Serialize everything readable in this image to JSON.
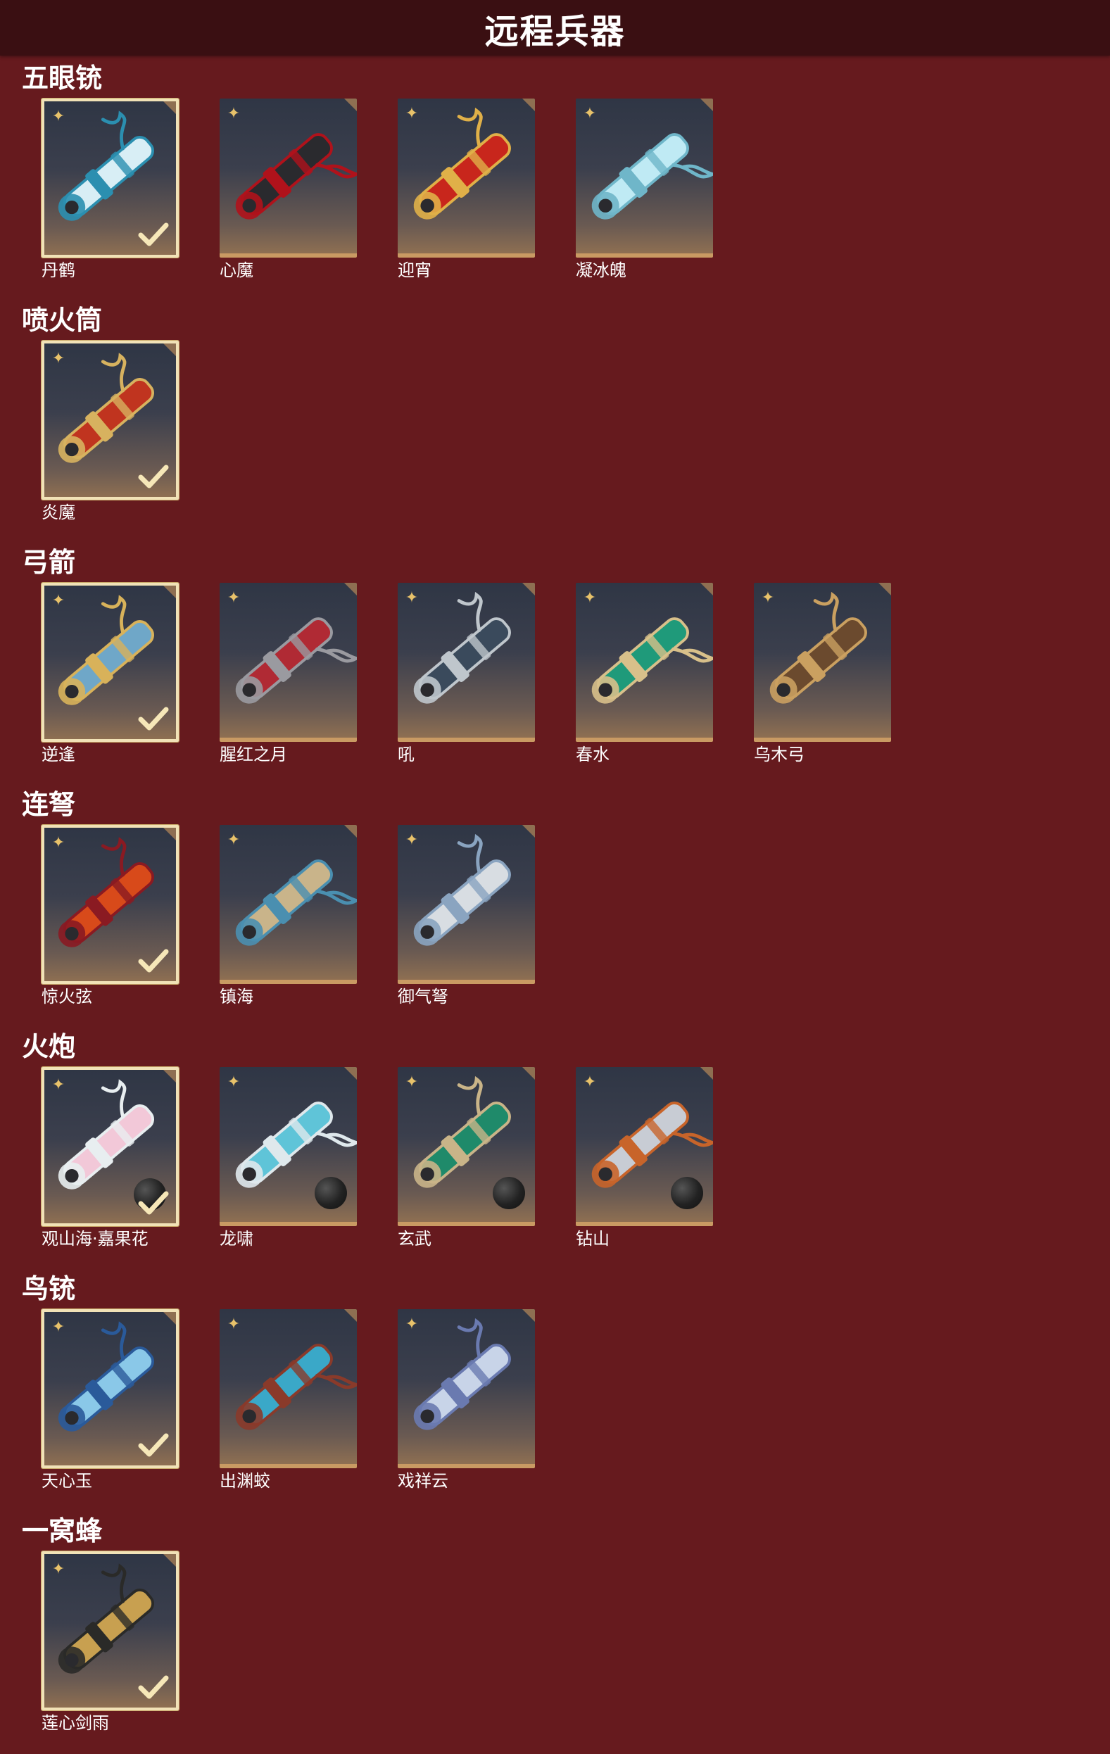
{
  "title": "远程兵器",
  "colors": {
    "background": "#661a1e",
    "header": "#3a0f12",
    "card_border_owned": "#f1e2b7",
    "card_bottom_bar": "#c99a63",
    "rarity_icon": "#e8c26a"
  },
  "sections": [
    {
      "name": "五眼铳",
      "items": [
        {
          "name": "丹鹤",
          "owned": true,
          "art": "teal-white-crane-gun",
          "colors": [
            "#d8eef5",
            "#2b8fb0"
          ]
        },
        {
          "name": "心魔",
          "owned": false,
          "art": "black-red-demon-gun",
          "colors": [
            "#2a2a2e",
            "#b0121b"
          ]
        },
        {
          "name": "迎宵",
          "owned": false,
          "art": "red-gold-festive-gun",
          "colors": [
            "#c8261c",
            "#e0b048"
          ]
        },
        {
          "name": "凝冰魄",
          "owned": false,
          "art": "ice-crystal-gun",
          "colors": [
            "#bfeaf4",
            "#6fb6c9"
          ]
        }
      ]
    },
    {
      "name": "喷火筒",
      "items": [
        {
          "name": "炎魔",
          "owned": true,
          "art": "flame-tube",
          "colors": [
            "#c0341f",
            "#d7b25f"
          ]
        }
      ]
    },
    {
      "name": "弓箭",
      "items": [
        {
          "name": "逆逢",
          "owned": true,
          "art": "blue-gold-bow",
          "colors": [
            "#6fa7c8",
            "#d8b25a"
          ]
        },
        {
          "name": "腥红之月",
          "owned": false,
          "art": "crimson-moon-bow",
          "colors": [
            "#b02a34",
            "#9a9aa0"
          ]
        },
        {
          "name": "吼",
          "owned": false,
          "art": "dark-silver-bow",
          "colors": [
            "#3a4a5c",
            "#bfc6cc"
          ]
        },
        {
          "name": "春水",
          "owned": false,
          "art": "jade-bow",
          "colors": [
            "#1f9a7a",
            "#d8c08a"
          ]
        },
        {
          "name": "乌木弓",
          "owned": false,
          "art": "ebony-bow",
          "colors": [
            "#6b4a2e",
            "#caa060"
          ]
        }
      ]
    },
    {
      "name": "连弩",
      "items": [
        {
          "name": "惊火弦",
          "owned": true,
          "art": "fire-crossbow",
          "colors": [
            "#d84a1a",
            "#8a1a22"
          ]
        },
        {
          "name": "镇海",
          "owned": false,
          "art": "sea-crossbow",
          "colors": [
            "#c9b48a",
            "#4a8fb0"
          ]
        },
        {
          "name": "御气弩",
          "owned": false,
          "art": "silver-crossbow",
          "colors": [
            "#d8dde2",
            "#8aa4c0"
          ]
        }
      ]
    },
    {
      "name": "火炮",
      "items": [
        {
          "name": "观山海·嘉果花",
          "owned": true,
          "art": "flower-cannon",
          "colors": [
            "#f2c8d8",
            "#e8eef0"
          ],
          "cannonball": true
        },
        {
          "name": "龙啸",
          "owned": false,
          "art": "dragon-cannon",
          "colors": [
            "#5fc4d8",
            "#dfe8ec"
          ],
          "cannonball": true
        },
        {
          "name": "玄武",
          "owned": false,
          "art": "serpent-cannon",
          "colors": [
            "#1f8a6a",
            "#c9b488"
          ],
          "cannonball": true
        },
        {
          "name": "钻山",
          "owned": false,
          "art": "drill-cannon",
          "colors": [
            "#c8ccd4",
            "#c8642a"
          ],
          "cannonball": true
        }
      ]
    },
    {
      "name": "鸟铳",
      "items": [
        {
          "name": "天心玉",
          "owned": true,
          "art": "jade-musket",
          "colors": [
            "#8ac8e8",
            "#2a5a9a"
          ]
        },
        {
          "name": "出渊蛟",
          "owned": false,
          "art": "sea-dragon-musket",
          "colors": [
            "#3aa8c8",
            "#8a3a2a"
          ]
        },
        {
          "name": "戏祥云",
          "owned": false,
          "art": "cloud-musket",
          "colors": [
            "#c8d4e8",
            "#6a7ab0"
          ]
        }
      ]
    },
    {
      "name": "一窝蜂",
      "items": [
        {
          "name": "莲心剑雨",
          "owned": true,
          "art": "golden-rocket-launcher",
          "colors": [
            "#c8a050",
            "#2a2a28"
          ]
        }
      ]
    }
  ]
}
